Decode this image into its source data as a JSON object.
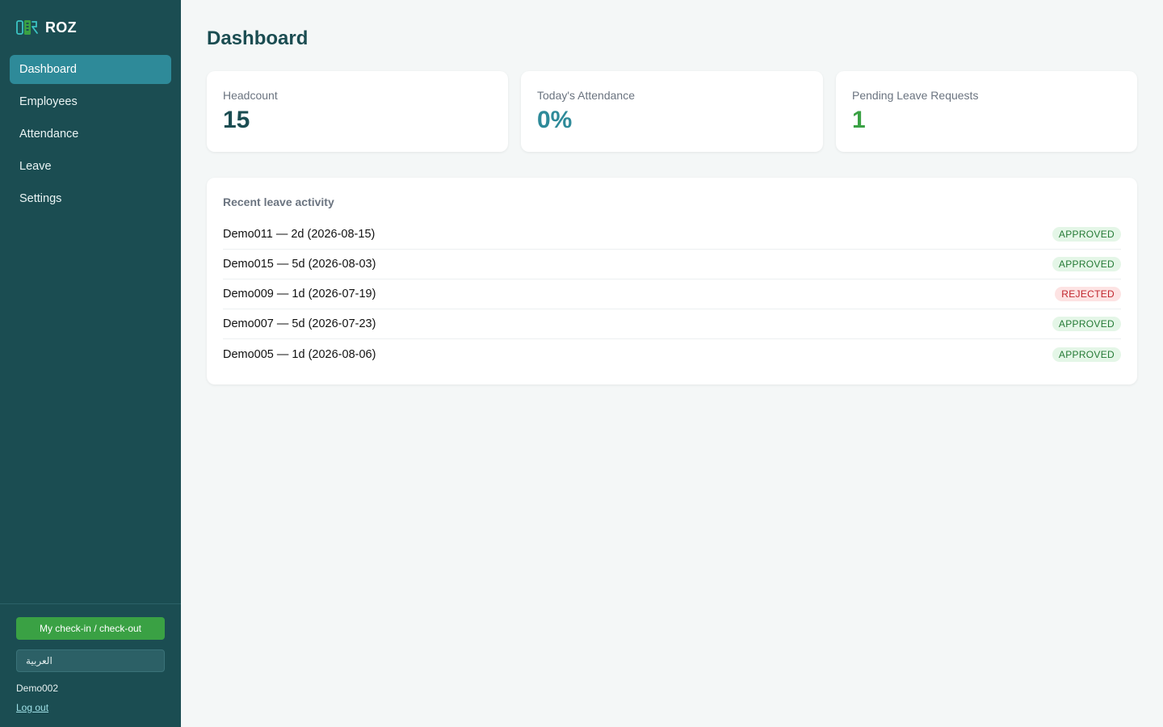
{
  "app": {
    "brand": "ROZ",
    "logo_icon": "roz-logo-icon",
    "accent_color": "#2e8a99",
    "sidebar_color": "#1b4d52"
  },
  "nav": {
    "items": [
      {
        "label": "Dashboard",
        "active": true
      },
      {
        "label": "Employees",
        "active": false
      },
      {
        "label": "Attendance",
        "active": false
      },
      {
        "label": "Leave",
        "active": false
      },
      {
        "label": "Settings",
        "active": false
      }
    ]
  },
  "sidebar_footer": {
    "checkin_label": "My check-in / check-out",
    "language": "العربية",
    "username": "Demo002",
    "logout_label": "Log out"
  },
  "page": {
    "title": "Dashboard"
  },
  "stats": [
    {
      "label": "Headcount",
      "value": "15",
      "color": "#1b4d52"
    },
    {
      "label": "Today's Attendance",
      "value": "0%",
      "color": "#2e8a99"
    },
    {
      "label": "Pending Leave Requests",
      "value": "1",
      "color": "#3aa144"
    }
  ],
  "activity": {
    "title": "Recent leave activity",
    "rows": [
      {
        "text": "Demo011 — 2d (2026-08-15)",
        "status": "APPROVED"
      },
      {
        "text": "Demo015 — 5d (2026-08-03)",
        "status": "APPROVED"
      },
      {
        "text": "Demo009 — 1d (2026-07-19)",
        "status": "REJECTED"
      },
      {
        "text": "Demo007 — 5d (2026-07-23)",
        "status": "APPROVED"
      },
      {
        "text": "Demo005 — 1d (2026-08-06)",
        "status": "APPROVED"
      }
    ]
  }
}
